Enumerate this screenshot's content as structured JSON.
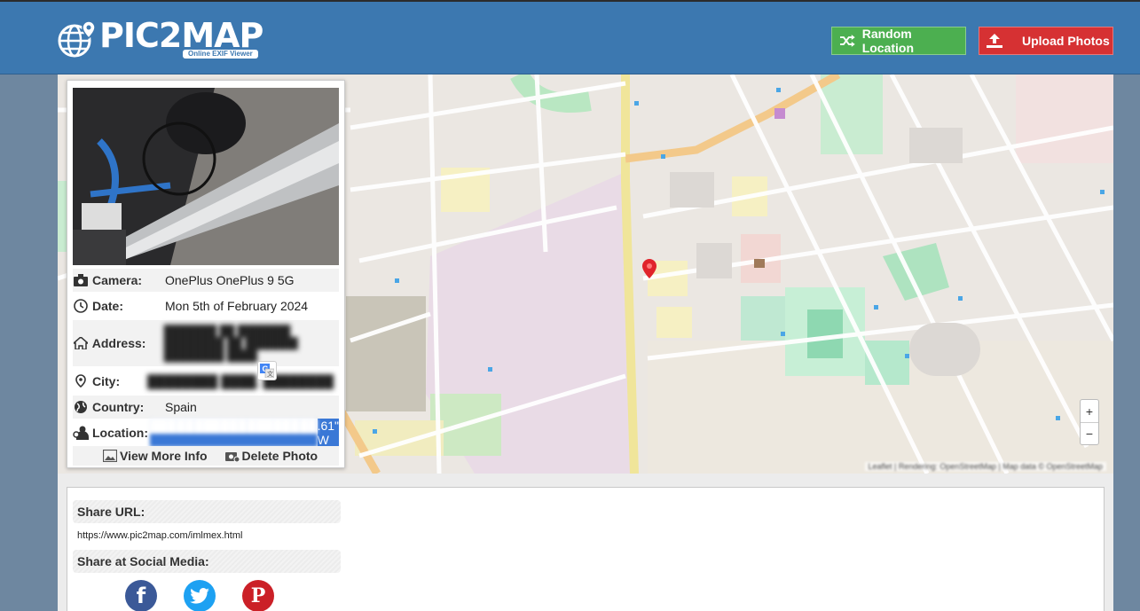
{
  "header": {
    "logo_text": "PIC2MAP",
    "logo_subtitle": "Online EXIF Viewer",
    "random_button": "Random Location",
    "upload_button": "Upload Photos"
  },
  "panel": {
    "camera_label": "Camera:",
    "camera_value": "OnePlus OnePlus 9 5G",
    "date_label": "Date:",
    "date_value": "Mon 5th of February 2024",
    "address_label": "Address:",
    "address_value": "███████ ██ ███████ ████████ ██ ███████ ████████ ████",
    "city_label": "City:",
    "city_value": "████████ ████, ████████",
    "country_label": "Country:",
    "country_value": "Spain",
    "location_label": "Location:",
    "location_value_hidden": "███████████████████",
    "location_value_tail": ".61\" W",
    "view_more": "View More Info",
    "delete_photo": "Delete Photo"
  },
  "map": {
    "attribution": "Leaflet | Rendering: OpenStreetMap | Map data © OpenStreetMap",
    "zoom_in": "+",
    "zoom_out": "−"
  },
  "share": {
    "url_heading": "Share URL:",
    "url_value": "https://www.pic2map.com/imlmex.html",
    "social_heading": "Share at Social Media:",
    "facebook": "f",
    "pinterest": "P"
  },
  "colors": {
    "header_blue": "#3c78b0",
    "random_green": "#4caf50",
    "upload_red": "#d63133",
    "facebook": "#3b5998",
    "twitter": "#1da1f2",
    "pinterest": "#cb2027"
  }
}
